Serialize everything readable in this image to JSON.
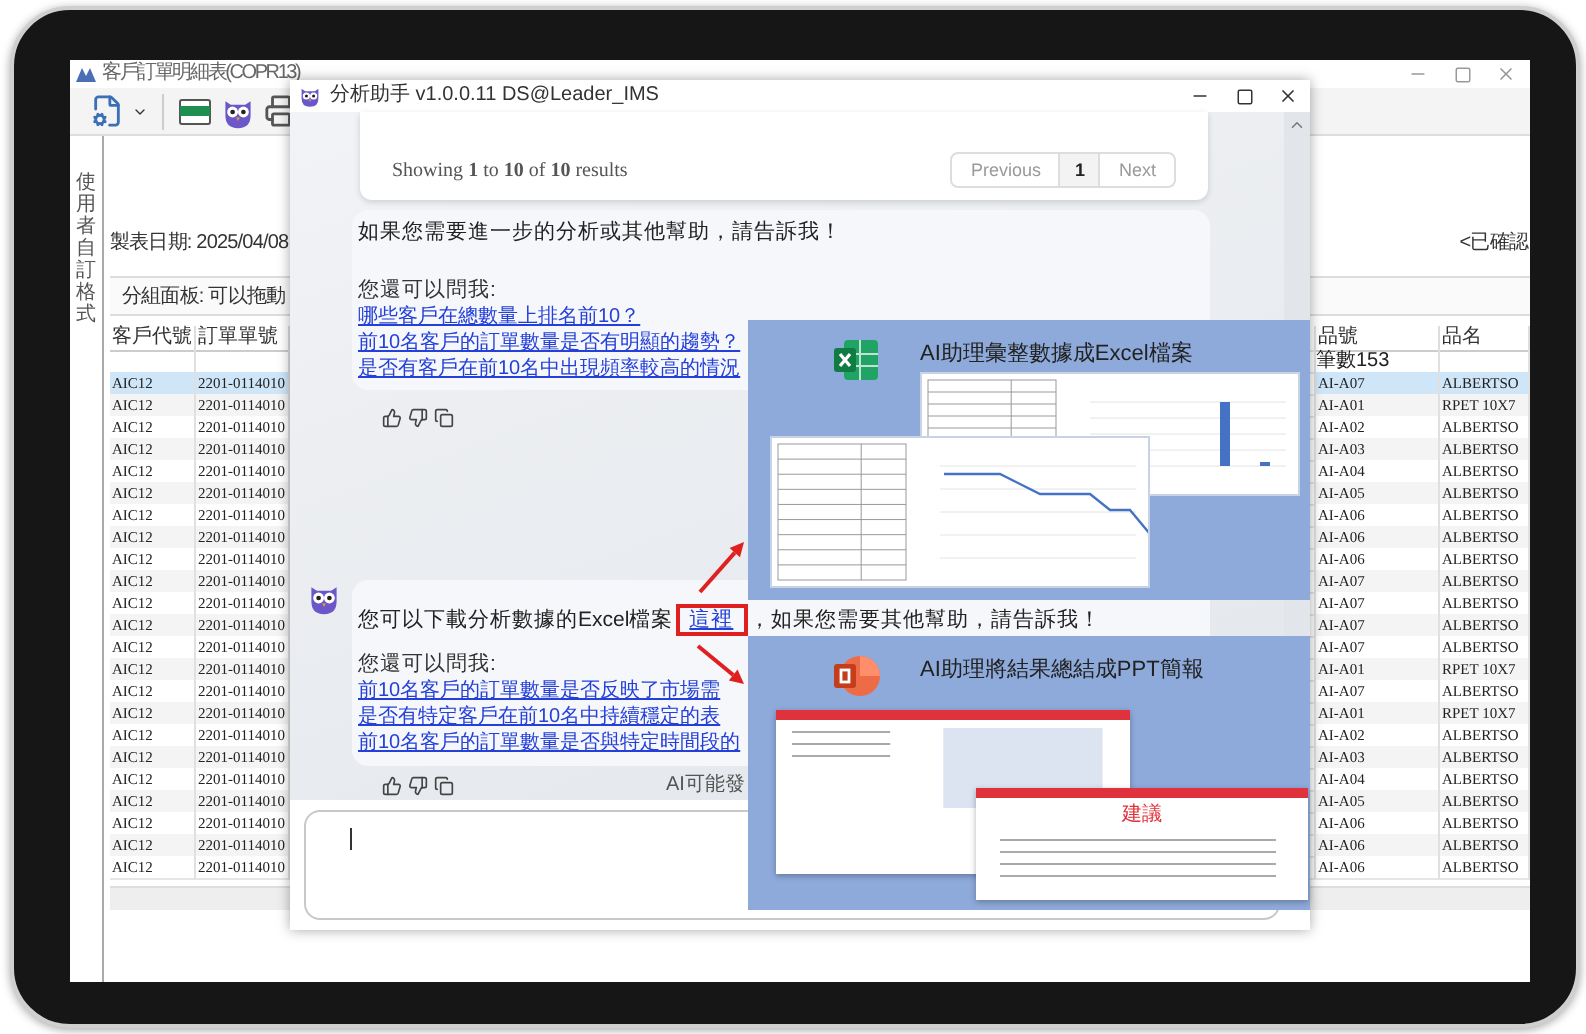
{
  "erp_window": {
    "title": "客戶訂單明細表(COPR13)",
    "side_tab": "使用者自訂格式",
    "report_date": "製表日期: 2025/04/08",
    "confirm_label": "<已確認",
    "group_panel": "分組面板: 可以拖動",
    "table": {
      "columns": [
        "客戶代號",
        "訂單單號",
        "品號",
        "品名"
      ],
      "count_label": "筆數153",
      "rows": [
        {
          "cells": [
            "AIC12",
            "2201-0114010",
            "AI-A07",
            "ALBERTSO"
          ],
          "selected": true
        },
        {
          "cells": [
            "AIC12",
            "2201-0114010",
            "AI-A01",
            "RPET 10X7"
          ],
          "selected": false
        },
        {
          "cells": [
            "AIC12",
            "2201-0114010",
            "AI-A02",
            "ALBERTSO"
          ],
          "selected": false
        },
        {
          "cells": [
            "AIC12",
            "2201-0114010",
            "AI-A03",
            "ALBERTSO"
          ],
          "selected": false
        },
        {
          "cells": [
            "AIC12",
            "2201-0114010",
            "AI-A04",
            "ALBERTSO"
          ],
          "selected": false
        },
        {
          "cells": [
            "AIC12",
            "2201-0114010",
            "AI-A05",
            "ALBERTSO"
          ],
          "selected": false
        },
        {
          "cells": [
            "AIC12",
            "2201-0114010",
            "AI-A06",
            "ALBERTSO"
          ],
          "selected": false
        },
        {
          "cells": [
            "AIC12",
            "2201-0114010",
            "AI-A06",
            "ALBERTSO"
          ],
          "selected": false
        },
        {
          "cells": [
            "AIC12",
            "2201-0114010",
            "AI-A06",
            "ALBERTSO"
          ],
          "selected": false
        },
        {
          "cells": [
            "AIC12",
            "2201-0114010",
            "AI-A07",
            "ALBERTSO"
          ],
          "selected": false
        },
        {
          "cells": [
            "AIC12",
            "2201-0114010",
            "AI-A07",
            "ALBERTSO"
          ],
          "selected": false
        },
        {
          "cells": [
            "AIC12",
            "2201-0114010",
            "AI-A07",
            "ALBERTSO"
          ],
          "selected": false
        },
        {
          "cells": [
            "AIC12",
            "2201-0114010",
            "AI-A07",
            "ALBERTSO"
          ],
          "selected": false
        },
        {
          "cells": [
            "AIC12",
            "2201-0114010",
            "AI-A01",
            "RPET 10X7"
          ],
          "selected": false
        },
        {
          "cells": [
            "AIC12",
            "2201-0114010",
            "AI-A07",
            "ALBERTSO"
          ],
          "selected": false
        },
        {
          "cells": [
            "AIC12",
            "2201-0114010",
            "AI-A01",
            "RPET 10X7"
          ],
          "selected": false
        },
        {
          "cells": [
            "AIC12",
            "2201-0114010",
            "AI-A02",
            "ALBERTSO"
          ],
          "selected": false
        },
        {
          "cells": [
            "AIC12",
            "2201-0114010",
            "AI-A03",
            "ALBERTSO"
          ],
          "selected": false
        },
        {
          "cells": [
            "AIC12",
            "2201-0114010",
            "AI-A04",
            "ALBERTSO"
          ],
          "selected": false
        },
        {
          "cells": [
            "AIC12",
            "2201-0114010",
            "AI-A05",
            "ALBERTSO"
          ],
          "selected": false
        },
        {
          "cells": [
            "AIC12",
            "2201-0114010",
            "AI-A06",
            "ALBERTSO"
          ],
          "selected": false
        },
        {
          "cells": [
            "AIC12",
            "2201-0114010",
            "AI-A06",
            "ALBERTSO"
          ],
          "selected": false
        },
        {
          "cells": [
            "AIC12",
            "2201-0114010",
            "AI-A06",
            "ALBERTSO"
          ],
          "selected": false
        }
      ]
    }
  },
  "chat_window": {
    "title": "分析助手 v1.0.0.11 DS@Leader_IMS",
    "pagination": {
      "summary": "Showing **1** to **10** of **10** results",
      "buttons": [
        {
          "label": "Previous",
          "selected": false
        },
        {
          "label": "1",
          "selected": true
        },
        {
          "label": "Next",
          "selected": false
        }
      ]
    },
    "messages": [
      {
        "kind": "text",
        "avatar": false,
        "text": "如果您需要進一步的分析或其他幫助，請告訴我！",
        "suggest_label": "您還可以問我:",
        "suggestions": [
          "哪些客戶在總數量上排名前10？",
          "前10名客戶的訂單數量是否有明顯的趨勢？",
          "是否有客戶在前10名中出現頻率較高的情況"
        ]
      },
      {
        "kind": "download",
        "avatar": true,
        "before": "您可以下載分析數據的Excel檔案",
        "link": "這裡",
        "after": "，如果您需要其他幫助，請告訴我！",
        "suggest_label": "您還可以問我:",
        "suggestions": [
          "前10名客戶的訂單數量是否反映了市場需",
          "是否有特定客戶在前10名中持續穩定的表",
          "前10名客戶的訂單數量是否與特定時間段的"
        ]
      }
    ],
    "disclaimer": "AI可能發"
  },
  "callouts": [
    {
      "kind": "excel",
      "title": "AI助理彙整數據成Excel檔案"
    },
    {
      "kind": "ppt",
      "title": "AI助理將結果總結成PPT簡報",
      "slide_heading": "建議"
    }
  ]
}
